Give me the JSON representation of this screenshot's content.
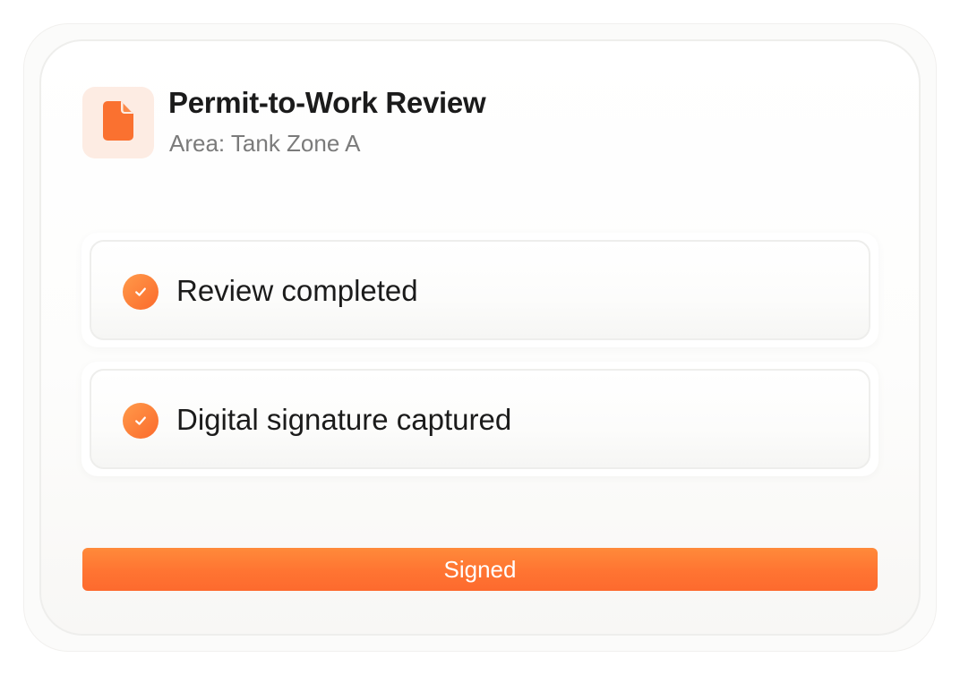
{
  "header": {
    "icon": "document-icon",
    "title": "Permit-to-Work Review",
    "subtitle": "Area: Tank Zone A"
  },
  "checklist": [
    {
      "label": "Review completed",
      "icon": "check-icon",
      "status": "done"
    },
    {
      "label": "Digital signature captured",
      "icon": "check-icon",
      "status": "done"
    }
  ],
  "action": {
    "label": "Signed"
  },
  "colors": {
    "accent": "#FF7A35",
    "accent_light": "#FDECE3",
    "title_text": "#1B1B1B",
    "muted_text": "#7B7B7B"
  }
}
